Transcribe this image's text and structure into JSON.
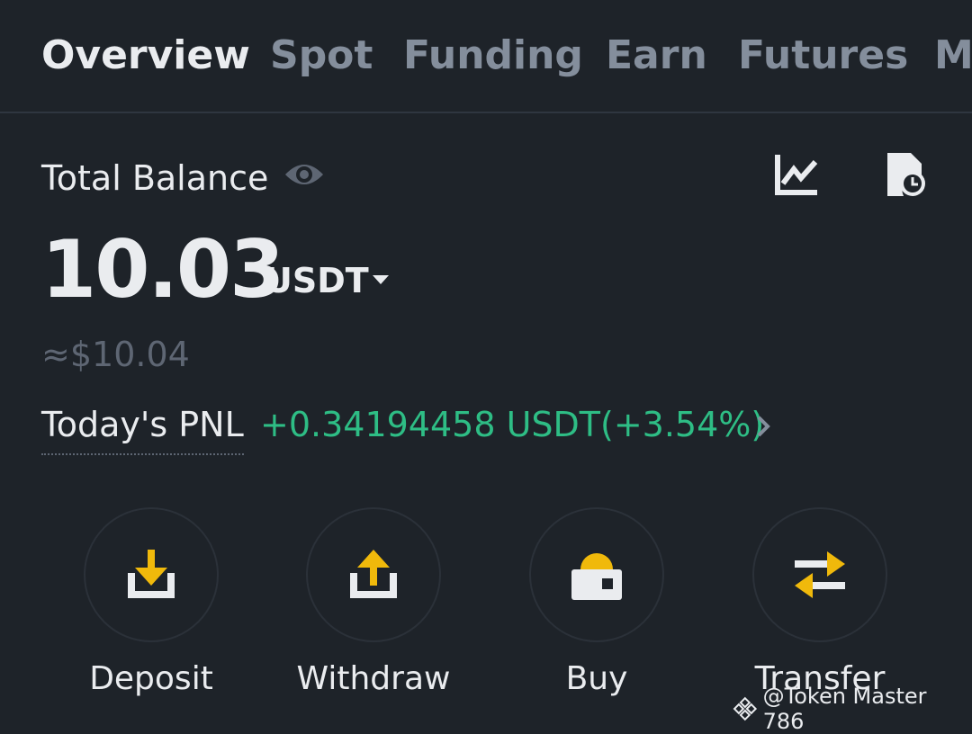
{
  "tabs": [
    {
      "label": "Overview",
      "active": true
    },
    {
      "label": "Spot",
      "active": false
    },
    {
      "label": "Funding",
      "active": false
    },
    {
      "label": "Earn",
      "active": false
    },
    {
      "label": "Futures",
      "active": false
    },
    {
      "label": "Ma",
      "active": false
    }
  ],
  "balance": {
    "label": "Total Balance",
    "value": "10.03",
    "currency": "USDT",
    "approx": "≈$10.04",
    "icons": {
      "visibility": "eye-icon",
      "chart": "chart-icon",
      "history": "history-icon"
    }
  },
  "pnl": {
    "label": "Today's PNL",
    "value": "+0.34194458 USDT(+3.54%)"
  },
  "actions": [
    {
      "label": "Deposit",
      "icon": "deposit-icon"
    },
    {
      "label": "Withdraw",
      "icon": "withdraw-icon"
    },
    {
      "label": "Buy",
      "icon": "buy-icon"
    },
    {
      "label": "Transfer",
      "icon": "transfer-icon"
    }
  ],
  "watermark": {
    "text": "@Token Master 786"
  },
  "colors": {
    "background": "#1e2329",
    "text_primary": "#eaecef",
    "text_muted": "#848e9c",
    "accent_yellow": "#f0b90b",
    "positive": "#2ebd85"
  }
}
